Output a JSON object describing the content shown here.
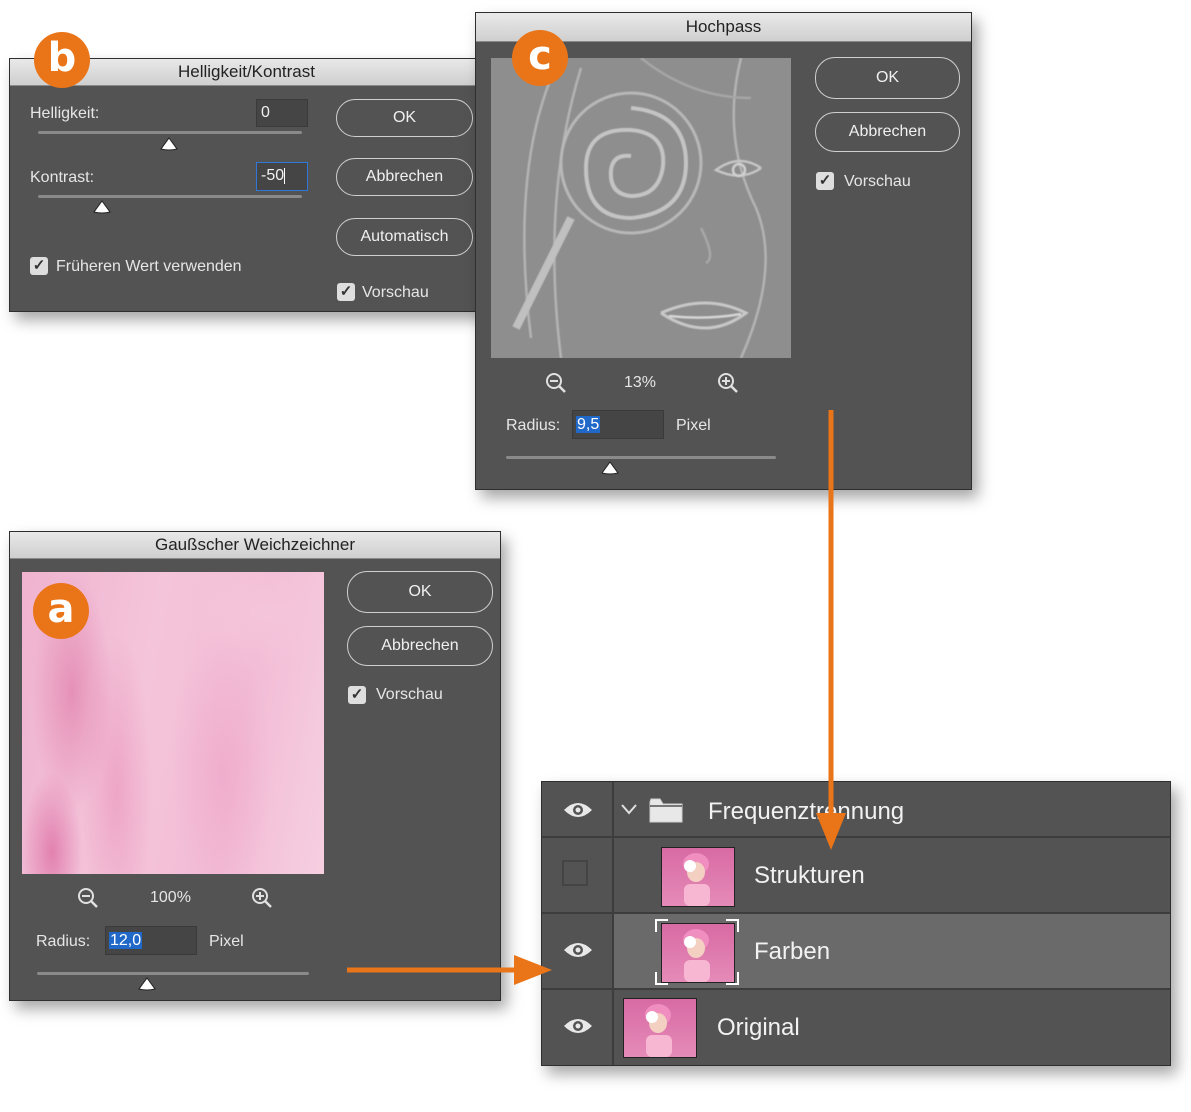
{
  "badges": {
    "a": "a",
    "b": "b",
    "c": "c"
  },
  "brightness_dialog": {
    "title": "Helligkeit/Kontrast",
    "brightness_label": "Helligkeit:",
    "brightness_value": "0",
    "contrast_label": "Kontrast:",
    "contrast_value": "-50",
    "legacy_label": "Früheren Wert verwenden",
    "ok": "OK",
    "cancel": "Abbrechen",
    "auto": "Automatisch",
    "preview": "Vorschau"
  },
  "highpass_dialog": {
    "title": "Hochpass",
    "ok": "OK",
    "cancel": "Abbrechen",
    "preview": "Vorschau",
    "zoom": "13%",
    "radius_label": "Radius:",
    "radius_value": "9,5",
    "unit": "Pixel"
  },
  "gauss_dialog": {
    "title": "Gaußscher Weichzeichner",
    "ok": "OK",
    "cancel": "Abbrechen",
    "preview": "Vorschau",
    "zoom": "100%",
    "radius_label": "Radius:",
    "radius_value": "12,0",
    "unit": "Pixel"
  },
  "layers_panel": {
    "group": "Frequenztrennung",
    "layers": [
      {
        "name": "Strukturen",
        "visible": false
      },
      {
        "name": "Farben",
        "visible": true,
        "selected": true
      },
      {
        "name": "Original",
        "visible": true
      }
    ]
  },
  "colors": {
    "accent": "#ea7418",
    "panel": "#535353",
    "selection": "#2169c8"
  }
}
